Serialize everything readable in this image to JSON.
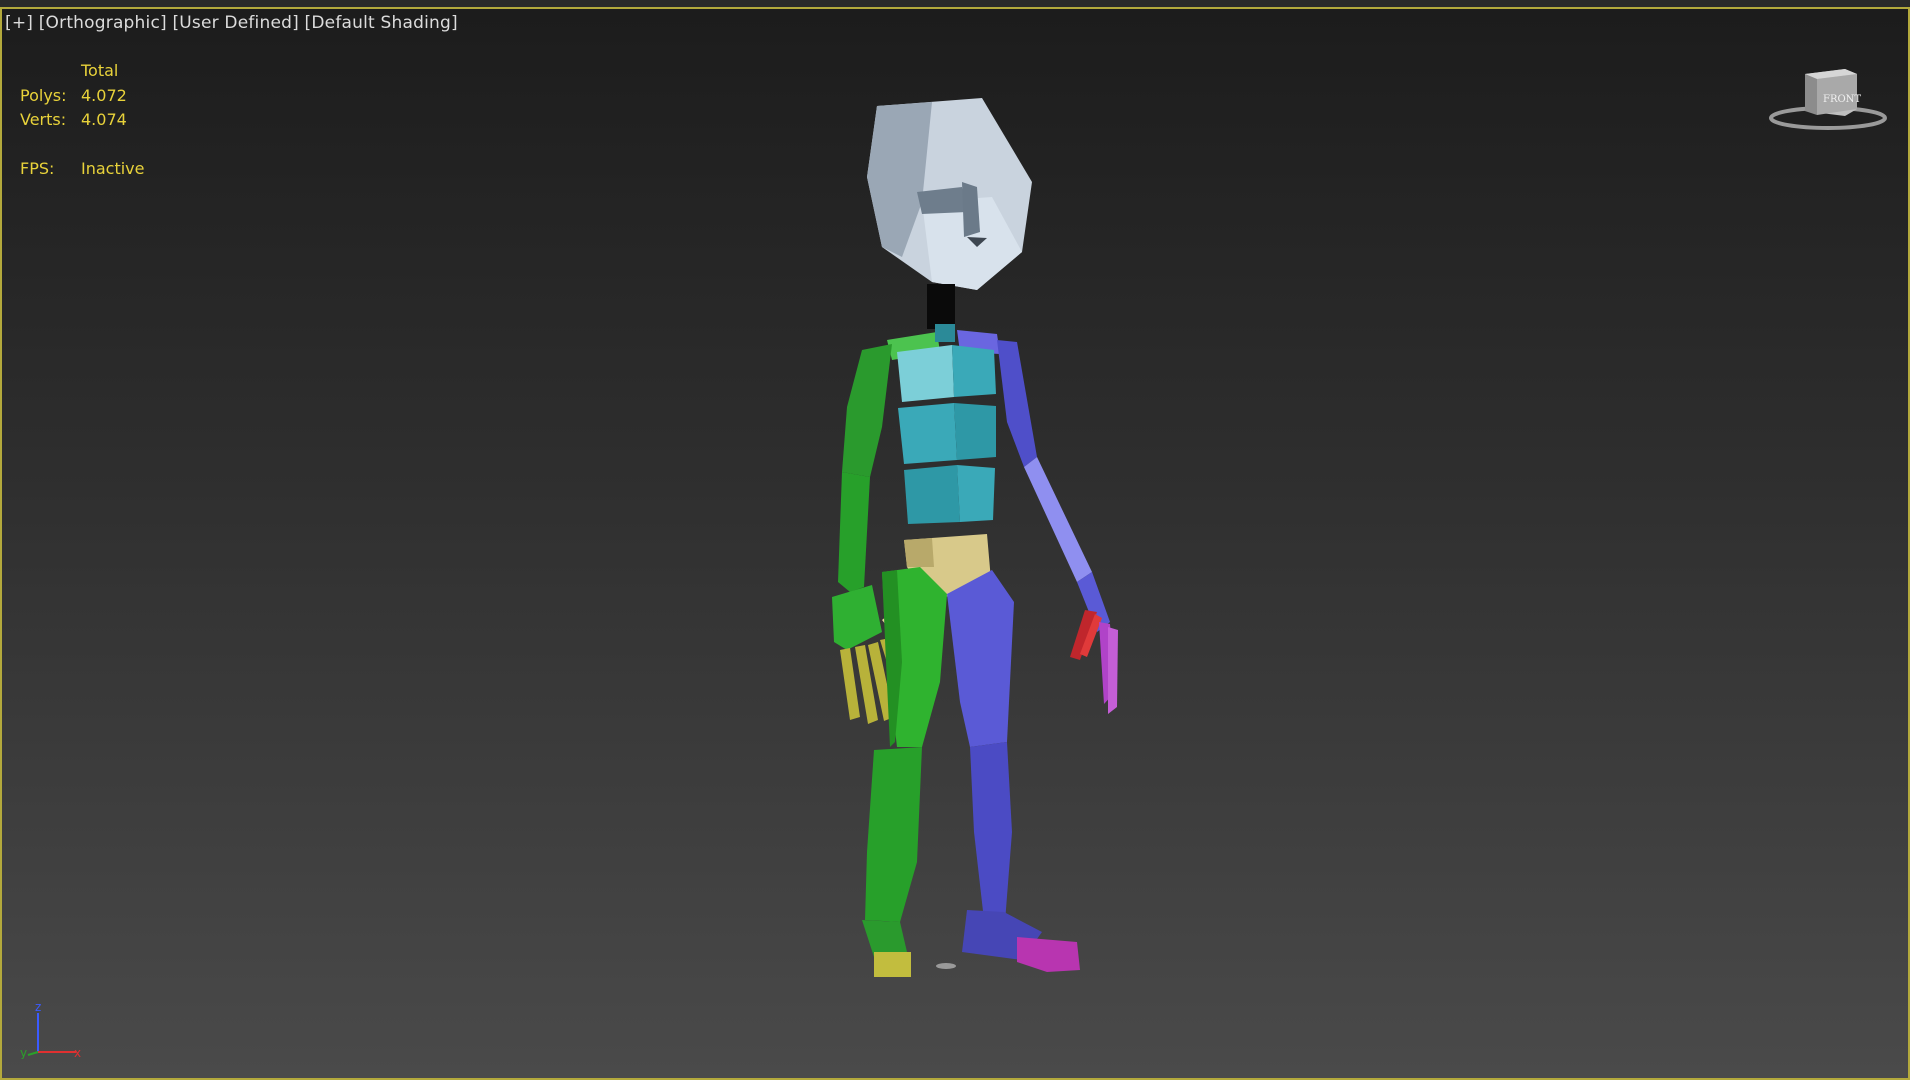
{
  "viewport": {
    "label_plus": "[+]",
    "label_view": "[Orthographic]",
    "label_mode": "[User Defined]",
    "label_shading": "[Default Shading]",
    "border_color": "#b3a93c"
  },
  "stats": {
    "total_label": "Total",
    "polys_label": "Polys:",
    "polys_value": "4.072",
    "verts_label": "Verts:",
    "verts_value": "4.074",
    "fps_label": "FPS:",
    "fps_value": "Inactive",
    "color": "#e8d23a"
  },
  "viewcube": {
    "face_label": "FRONT",
    "icon": "viewcube-icon"
  },
  "axis": {
    "x": "x",
    "y": "y",
    "z": "z",
    "icon": "axis-tripod-icon"
  },
  "scene": {
    "object": "biped-character",
    "colors": {
      "head": "#c9d3de",
      "torso": "#3aa9b8",
      "pelvis": "#d8c98a",
      "left_side": "#27a02a",
      "right_side": "#5a5ad6",
      "left_fingers": "#b8b23a",
      "right_fingers_a": "#c0262c",
      "right_fingers_b": "#b043c8",
      "left_toe": "#c2bd3e",
      "right_toe": "#b835b0"
    }
  }
}
